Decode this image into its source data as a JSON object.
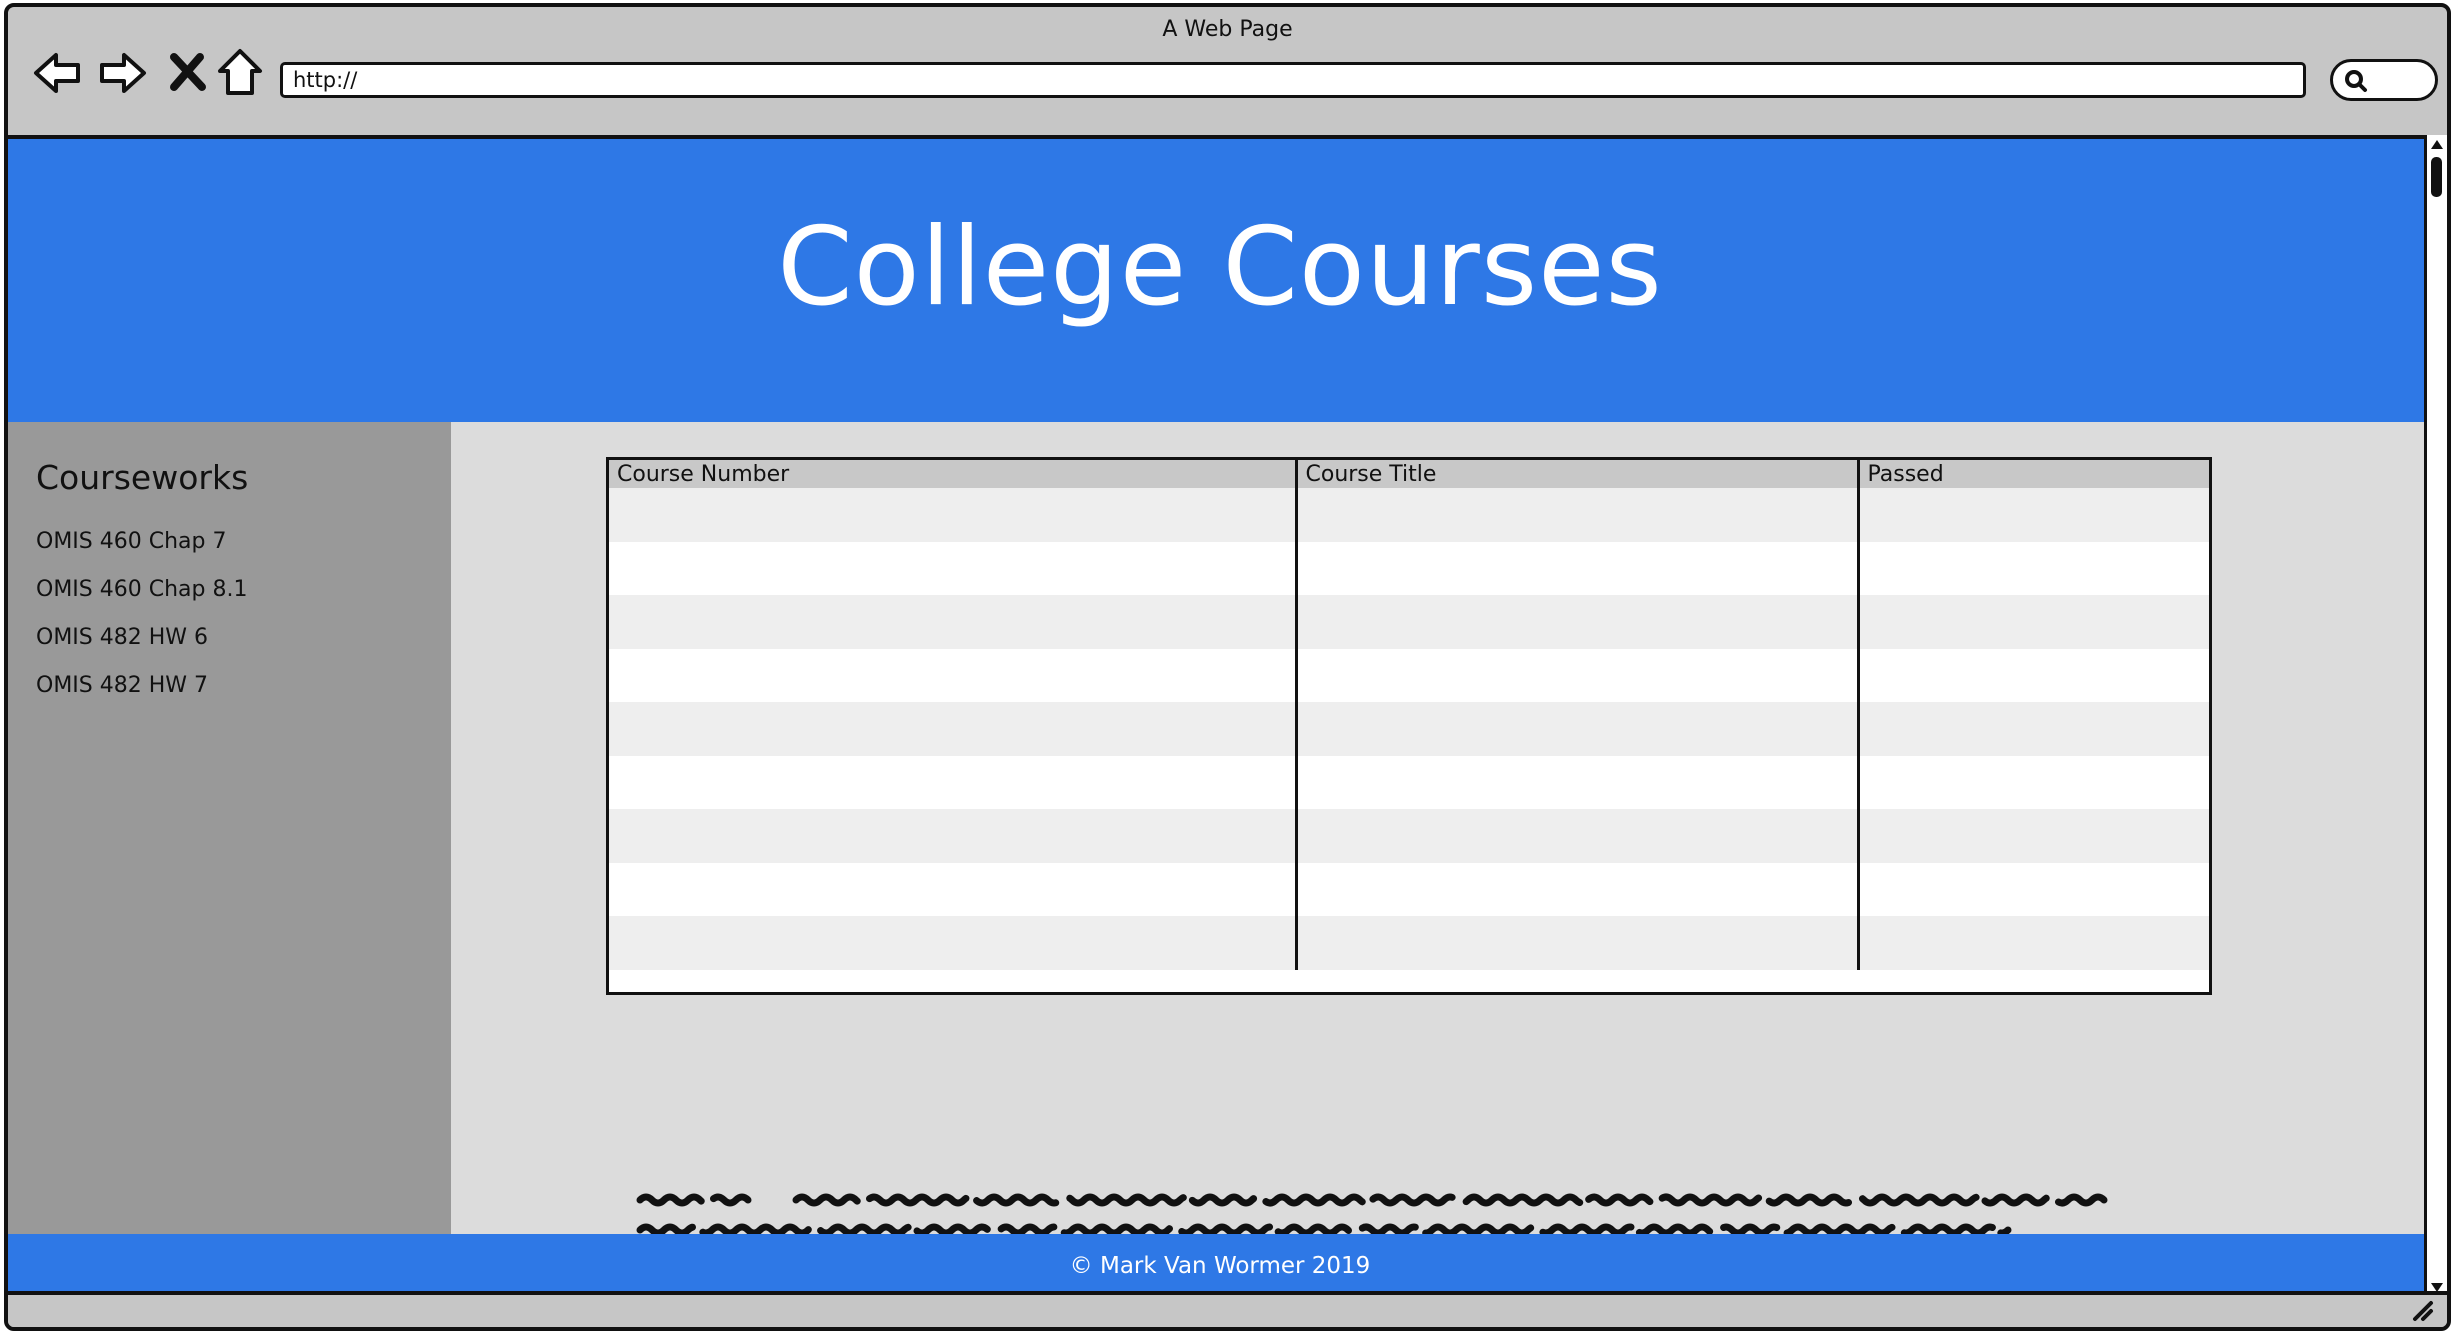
{
  "browser": {
    "window_title": "A Web Page",
    "url": "http://"
  },
  "header": {
    "title": "College Courses",
    "bg_color": "#2e78e6"
  },
  "sidebar": {
    "heading": "Courseworks",
    "items": [
      {
        "label": "OMIS 460 Chap 7"
      },
      {
        "label": "OMIS 460 Chap 8.1"
      },
      {
        "label": "OMIS 482 HW 6"
      },
      {
        "label": "OMIS 482 HW 7"
      }
    ]
  },
  "table": {
    "columns": [
      "Course Number",
      "Course Title",
      "Passed"
    ],
    "rows": [
      [
        "",
        "",
        ""
      ],
      [
        "",
        "",
        ""
      ],
      [
        "",
        "",
        ""
      ],
      [
        "",
        "",
        ""
      ],
      [
        "",
        "",
        ""
      ],
      [
        "",
        "",
        ""
      ],
      [
        "",
        "",
        ""
      ],
      [
        "",
        "",
        ""
      ],
      [
        "",
        "",
        ""
      ]
    ]
  },
  "footer": {
    "text": "© Mark Van Wormer 2019"
  },
  "icons": {
    "back": "arrow-left-icon",
    "forward": "arrow-right-icon",
    "stop": "close-icon",
    "home": "home-icon",
    "search": "search-icon"
  }
}
